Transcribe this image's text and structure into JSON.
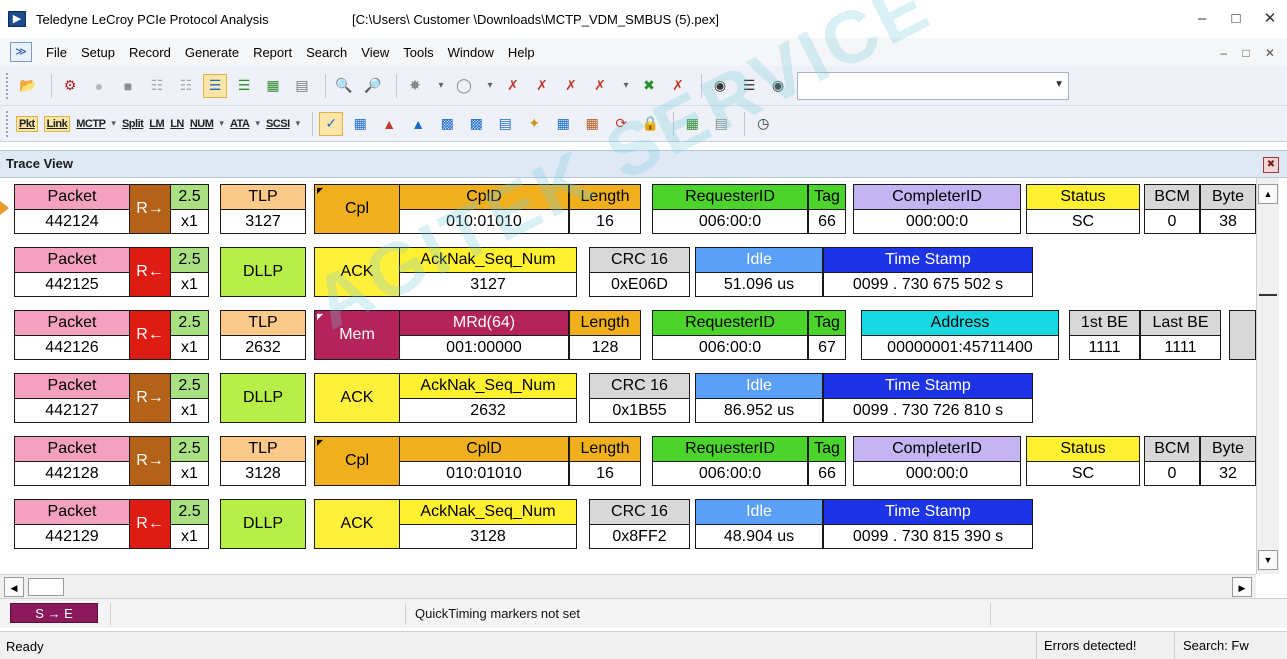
{
  "window": {
    "app_title": "Teledyne LeCroy PCIe Protocol Analysis",
    "file_path": "[C:\\Users\\ Customer \\Downloads\\MCTP_VDM_SMBUS (5).pex]",
    "minimize": "–",
    "maximize": "□",
    "close": "✕"
  },
  "menu": {
    "items": [
      "File",
      "Setup",
      "Record",
      "Generate",
      "Report",
      "Search",
      "View",
      "Tools",
      "Window",
      "Help"
    ],
    "mdi_controls": "– □ ✕"
  },
  "toolbar2": {
    "labels": [
      "Pkt",
      "Link",
      "MCTP",
      "Split",
      "LM",
      "LN",
      "NUM",
      "ATA",
      "SCSI"
    ]
  },
  "trace_view": {
    "title": "Trace View",
    "watermark": "AGITEK SERVICE"
  },
  "packets": [
    {
      "label": "Packet",
      "number": "442124",
      "dir": "R→",
      "speed": "2.5",
      "width": "x1",
      "type": "TLP",
      "type_value": "3127",
      "kind": "Cpl",
      "fields": [
        {
          "h": "CplD",
          "v": "010:01010"
        },
        {
          "h": "Length",
          "v": "16"
        },
        {
          "h": "RequesterID",
          "v": "006:00:0"
        },
        {
          "h": "Tag",
          "v": "66"
        },
        {
          "h": "CompleterID",
          "v": "000:00:0"
        },
        {
          "h": "Status",
          "v": "SC"
        },
        {
          "h": "BCM",
          "v": "0"
        },
        {
          "h": "Byte",
          "v": "38"
        }
      ]
    },
    {
      "label": "Packet",
      "number": "442125",
      "dir": "R←",
      "speed": "2.5",
      "width": "x1",
      "type": "DLLP",
      "kind": "ACK",
      "fields": [
        {
          "h": "AckNak_Seq_Num",
          "v": "3127"
        },
        {
          "h": "CRC 16",
          "v": "0xE06D"
        },
        {
          "h": "Idle",
          "v": "51.096 us"
        },
        {
          "h": "Time Stamp",
          "v": "0099 . 730 675 502 s"
        }
      ]
    },
    {
      "label": "Packet",
      "number": "442126",
      "dir": "R←",
      "speed": "2.5",
      "width": "x1",
      "type": "TLP",
      "type_value": "2632",
      "kind": "Mem",
      "fields": [
        {
          "h": "MRd(64)",
          "v": "001:00000"
        },
        {
          "h": "Length",
          "v": "128"
        },
        {
          "h": "RequesterID",
          "v": "006:00:0"
        },
        {
          "h": "Tag",
          "v": "67"
        },
        {
          "h": "Address",
          "v": "00000001:45711400"
        },
        {
          "h": "1st BE",
          "v": "1111"
        },
        {
          "h": "Last BE",
          "v": "1111"
        }
      ]
    },
    {
      "label": "Packet",
      "number": "442127",
      "dir": "R→",
      "speed": "2.5",
      "width": "x1",
      "type": "DLLP",
      "kind": "ACK",
      "fields": [
        {
          "h": "AckNak_Seq_Num",
          "v": "2632"
        },
        {
          "h": "CRC 16",
          "v": "0x1B55"
        },
        {
          "h": "Idle",
          "v": "86.952 us"
        },
        {
          "h": "Time Stamp",
          "v": "0099 . 730 726 810 s"
        }
      ]
    },
    {
      "label": "Packet",
      "number": "442128",
      "dir": "R→",
      "speed": "2.5",
      "width": "x1",
      "type": "TLP",
      "type_value": "3128",
      "kind": "Cpl",
      "fields": [
        {
          "h": "CplD",
          "v": "010:01010"
        },
        {
          "h": "Length",
          "v": "16"
        },
        {
          "h": "RequesterID",
          "v": "006:00:0"
        },
        {
          "h": "Tag",
          "v": "66"
        },
        {
          "h": "CompleterID",
          "v": "000:00:0"
        },
        {
          "h": "Status",
          "v": "SC"
        },
        {
          "h": "BCM",
          "v": "0"
        },
        {
          "h": "Byte",
          "v": "32"
        }
      ]
    },
    {
      "label": "Packet",
      "number": "442129",
      "dir": "R←",
      "speed": "2.5",
      "width": "x1",
      "type": "DLLP",
      "kind": "ACK",
      "fields": [
        {
          "h": "AckNak_Seq_Num",
          "v": "3128"
        },
        {
          "h": "CRC 16",
          "v": "0x8FF2"
        },
        {
          "h": "Idle",
          "v": "48.904 us"
        },
        {
          "h": "Time Stamp",
          "v": "0099 . 730 815 390 s"
        }
      ]
    }
  ],
  "colors": {
    "packet": "#f4a0bf",
    "dir_right": "#b4621a",
    "dir_left": "#dd1d14",
    "speed": "#a8e082",
    "tlp": "#fbc98a",
    "dllp": "#b8ee48",
    "cpl": "#f0b01e",
    "ack": "#fff03c",
    "mem": "#b4245a",
    "cpld": "#f0b01e",
    "mrd": "#b4245a",
    "length": "#f0b01e",
    "requester": "#4cd42c",
    "tag": "#4cd42c",
    "completer": "#c4b4f2",
    "status": "#fff030",
    "bcm": "#d8d8d8",
    "acknak": "#fff030",
    "crc": "#d8d8d8",
    "idle": "#5aa0f8",
    "timestamp": "#1c34e6",
    "address": "#18d8e2",
    "be": "#d8d8d8"
  },
  "quick_timing": {
    "se_label": "S → E",
    "message": "QuickTiming markers not set"
  },
  "status": {
    "left": "Ready",
    "errors": "Errors detected!",
    "search": "Search: Fw"
  }
}
